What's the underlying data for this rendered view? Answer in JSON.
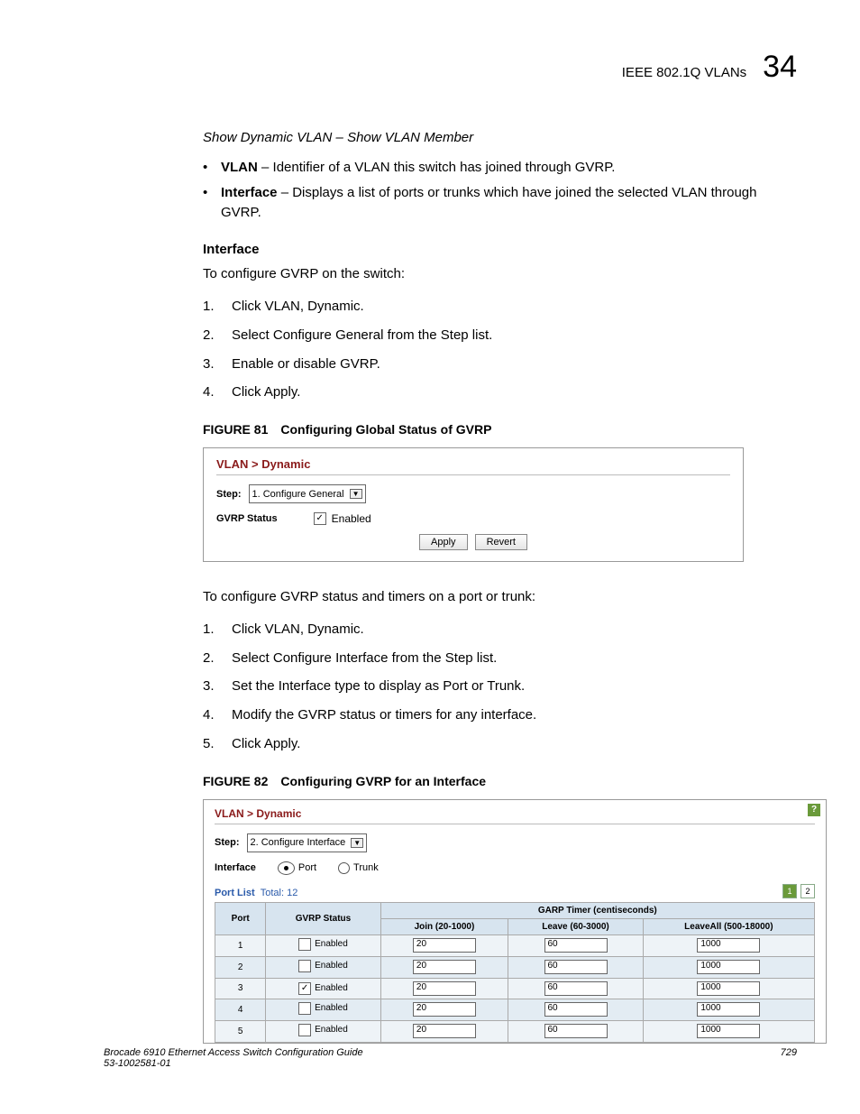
{
  "header": {
    "title": "IEEE 802.1Q VLANs",
    "chapter": "34"
  },
  "italic_line": "Show Dynamic VLAN – Show VLAN Member",
  "bullets": [
    {
      "term": "VLAN",
      "desc": " – Identifier of a VLAN this switch has joined through GVRP."
    },
    {
      "term": "Interface",
      "desc": " – Displays a list of ports or trunks which have joined the selected VLAN through GVRP."
    }
  ],
  "interface_h": "Interface",
  "intro1": "To configure GVRP on the switch:",
  "steps1": [
    "Click VLAN, Dynamic.",
    "Select Configure General from the Step list.",
    "Enable or disable GVRP.",
    "Click Apply."
  ],
  "fig81": {
    "label": "FIGURE 81",
    "title": "Configuring Global Status of GVRP"
  },
  "panel1": {
    "bc1": "VLAN",
    "bc2": "Dynamic",
    "step_lbl": "Step:",
    "step_val": "1. Configure General",
    "gvrp_lbl": "GVRP Status",
    "enabled_lbl": "Enabled",
    "apply": "Apply",
    "revert": "Revert"
  },
  "intro2": "To configure GVRP status and timers on a port or trunk:",
  "steps2": [
    "Click VLAN, Dynamic.",
    "Select Configure Interface from the Step list.",
    "Set the Interface type to display as Port or Trunk.",
    "Modify the GVRP status or timers for any interface.",
    "Click Apply."
  ],
  "fig82": {
    "label": "FIGURE 82",
    "title": "Configuring GVRP for an Interface"
  },
  "panel2": {
    "bc1": "VLAN",
    "bc2": "Dynamic",
    "step_lbl": "Step:",
    "step_val": "2. Configure Interface",
    "interface_lbl": "Interface",
    "port": "Port",
    "trunk": "Trunk",
    "portlist": "Port List",
    "total": "Total: 12",
    "th_port": "Port",
    "th_gvrp": "GVRP Status",
    "th_garp": "GARP Timer (centiseconds)",
    "th_join": "Join (20-1000)",
    "th_leave": "Leave (60-3000)",
    "th_leaveall": "LeaveAll (500-18000)",
    "enabled_lbl": "Enabled",
    "rows": [
      {
        "port": "1",
        "checked": false,
        "join": "20",
        "leave": "60",
        "leaveall": "1000"
      },
      {
        "port": "2",
        "checked": false,
        "join": "20",
        "leave": "60",
        "leaveall": "1000"
      },
      {
        "port": "3",
        "checked": true,
        "join": "20",
        "leave": "60",
        "leaveall": "1000"
      },
      {
        "port": "4",
        "checked": false,
        "join": "20",
        "leave": "60",
        "leaveall": "1000"
      },
      {
        "port": "5",
        "checked": false,
        "join": "20",
        "leave": "60",
        "leaveall": "1000"
      }
    ],
    "page1": "1",
    "page2": "2"
  },
  "footer": {
    "line1": "Brocade 6910 Ethernet Access Switch Configuration Guide",
    "line2": "53-1002581-01",
    "pagenum": "729"
  }
}
